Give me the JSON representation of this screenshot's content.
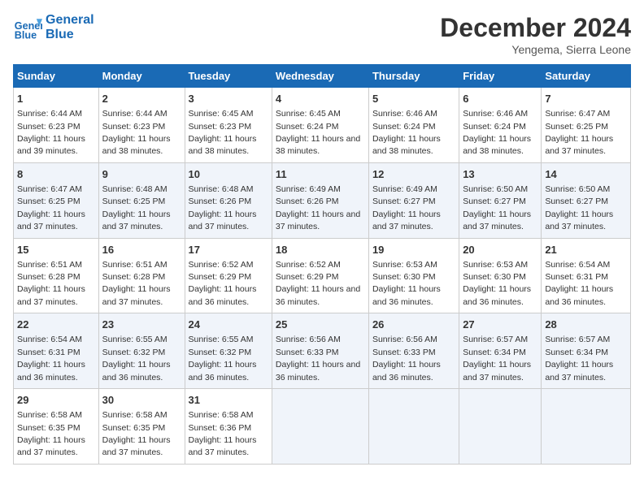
{
  "header": {
    "logo_line1": "General",
    "logo_line2": "Blue",
    "month": "December 2024",
    "location": "Yengema, Sierra Leone"
  },
  "days_of_week": [
    "Sunday",
    "Monday",
    "Tuesday",
    "Wednesday",
    "Thursday",
    "Friday",
    "Saturday"
  ],
  "weeks": [
    [
      {
        "day": 1,
        "sunrise": "6:44 AM",
        "sunset": "6:23 PM",
        "daylight": "11 hours and 39 minutes."
      },
      {
        "day": 2,
        "sunrise": "6:44 AM",
        "sunset": "6:23 PM",
        "daylight": "11 hours and 38 minutes."
      },
      {
        "day": 3,
        "sunrise": "6:45 AM",
        "sunset": "6:23 PM",
        "daylight": "11 hours and 38 minutes."
      },
      {
        "day": 4,
        "sunrise": "6:45 AM",
        "sunset": "6:24 PM",
        "daylight": "11 hours and 38 minutes."
      },
      {
        "day": 5,
        "sunrise": "6:46 AM",
        "sunset": "6:24 PM",
        "daylight": "11 hours and 38 minutes."
      },
      {
        "day": 6,
        "sunrise": "6:46 AM",
        "sunset": "6:24 PM",
        "daylight": "11 hours and 38 minutes."
      },
      {
        "day": 7,
        "sunrise": "6:47 AM",
        "sunset": "6:25 PM",
        "daylight": "11 hours and 37 minutes."
      }
    ],
    [
      {
        "day": 8,
        "sunrise": "6:47 AM",
        "sunset": "6:25 PM",
        "daylight": "11 hours and 37 minutes."
      },
      {
        "day": 9,
        "sunrise": "6:48 AM",
        "sunset": "6:25 PM",
        "daylight": "11 hours and 37 minutes."
      },
      {
        "day": 10,
        "sunrise": "6:48 AM",
        "sunset": "6:26 PM",
        "daylight": "11 hours and 37 minutes."
      },
      {
        "day": 11,
        "sunrise": "6:49 AM",
        "sunset": "6:26 PM",
        "daylight": "11 hours and 37 minutes."
      },
      {
        "day": 12,
        "sunrise": "6:49 AM",
        "sunset": "6:27 PM",
        "daylight": "11 hours and 37 minutes."
      },
      {
        "day": 13,
        "sunrise": "6:50 AM",
        "sunset": "6:27 PM",
        "daylight": "11 hours and 37 minutes."
      },
      {
        "day": 14,
        "sunrise": "6:50 AM",
        "sunset": "6:27 PM",
        "daylight": "11 hours and 37 minutes."
      }
    ],
    [
      {
        "day": 15,
        "sunrise": "6:51 AM",
        "sunset": "6:28 PM",
        "daylight": "11 hours and 37 minutes."
      },
      {
        "day": 16,
        "sunrise": "6:51 AM",
        "sunset": "6:28 PM",
        "daylight": "11 hours and 37 minutes."
      },
      {
        "day": 17,
        "sunrise": "6:52 AM",
        "sunset": "6:29 PM",
        "daylight": "11 hours and 36 minutes."
      },
      {
        "day": 18,
        "sunrise": "6:52 AM",
        "sunset": "6:29 PM",
        "daylight": "11 hours and 36 minutes."
      },
      {
        "day": 19,
        "sunrise": "6:53 AM",
        "sunset": "6:30 PM",
        "daylight": "11 hours and 36 minutes."
      },
      {
        "day": 20,
        "sunrise": "6:53 AM",
        "sunset": "6:30 PM",
        "daylight": "11 hours and 36 minutes."
      },
      {
        "day": 21,
        "sunrise": "6:54 AM",
        "sunset": "6:31 PM",
        "daylight": "11 hours and 36 minutes."
      }
    ],
    [
      {
        "day": 22,
        "sunrise": "6:54 AM",
        "sunset": "6:31 PM",
        "daylight": "11 hours and 36 minutes."
      },
      {
        "day": 23,
        "sunrise": "6:55 AM",
        "sunset": "6:32 PM",
        "daylight": "11 hours and 36 minutes."
      },
      {
        "day": 24,
        "sunrise": "6:55 AM",
        "sunset": "6:32 PM",
        "daylight": "11 hours and 36 minutes."
      },
      {
        "day": 25,
        "sunrise": "6:56 AM",
        "sunset": "6:33 PM",
        "daylight": "11 hours and 36 minutes."
      },
      {
        "day": 26,
        "sunrise": "6:56 AM",
        "sunset": "6:33 PM",
        "daylight": "11 hours and 36 minutes."
      },
      {
        "day": 27,
        "sunrise": "6:57 AM",
        "sunset": "6:34 PM",
        "daylight": "11 hours and 37 minutes."
      },
      {
        "day": 28,
        "sunrise": "6:57 AM",
        "sunset": "6:34 PM",
        "daylight": "11 hours and 37 minutes."
      }
    ],
    [
      {
        "day": 29,
        "sunrise": "6:58 AM",
        "sunset": "6:35 PM",
        "daylight": "11 hours and 37 minutes."
      },
      {
        "day": 30,
        "sunrise": "6:58 AM",
        "sunset": "6:35 PM",
        "daylight": "11 hours and 37 minutes."
      },
      {
        "day": 31,
        "sunrise": "6:58 AM",
        "sunset": "6:36 PM",
        "daylight": "11 hours and 37 minutes."
      },
      null,
      null,
      null,
      null
    ]
  ]
}
